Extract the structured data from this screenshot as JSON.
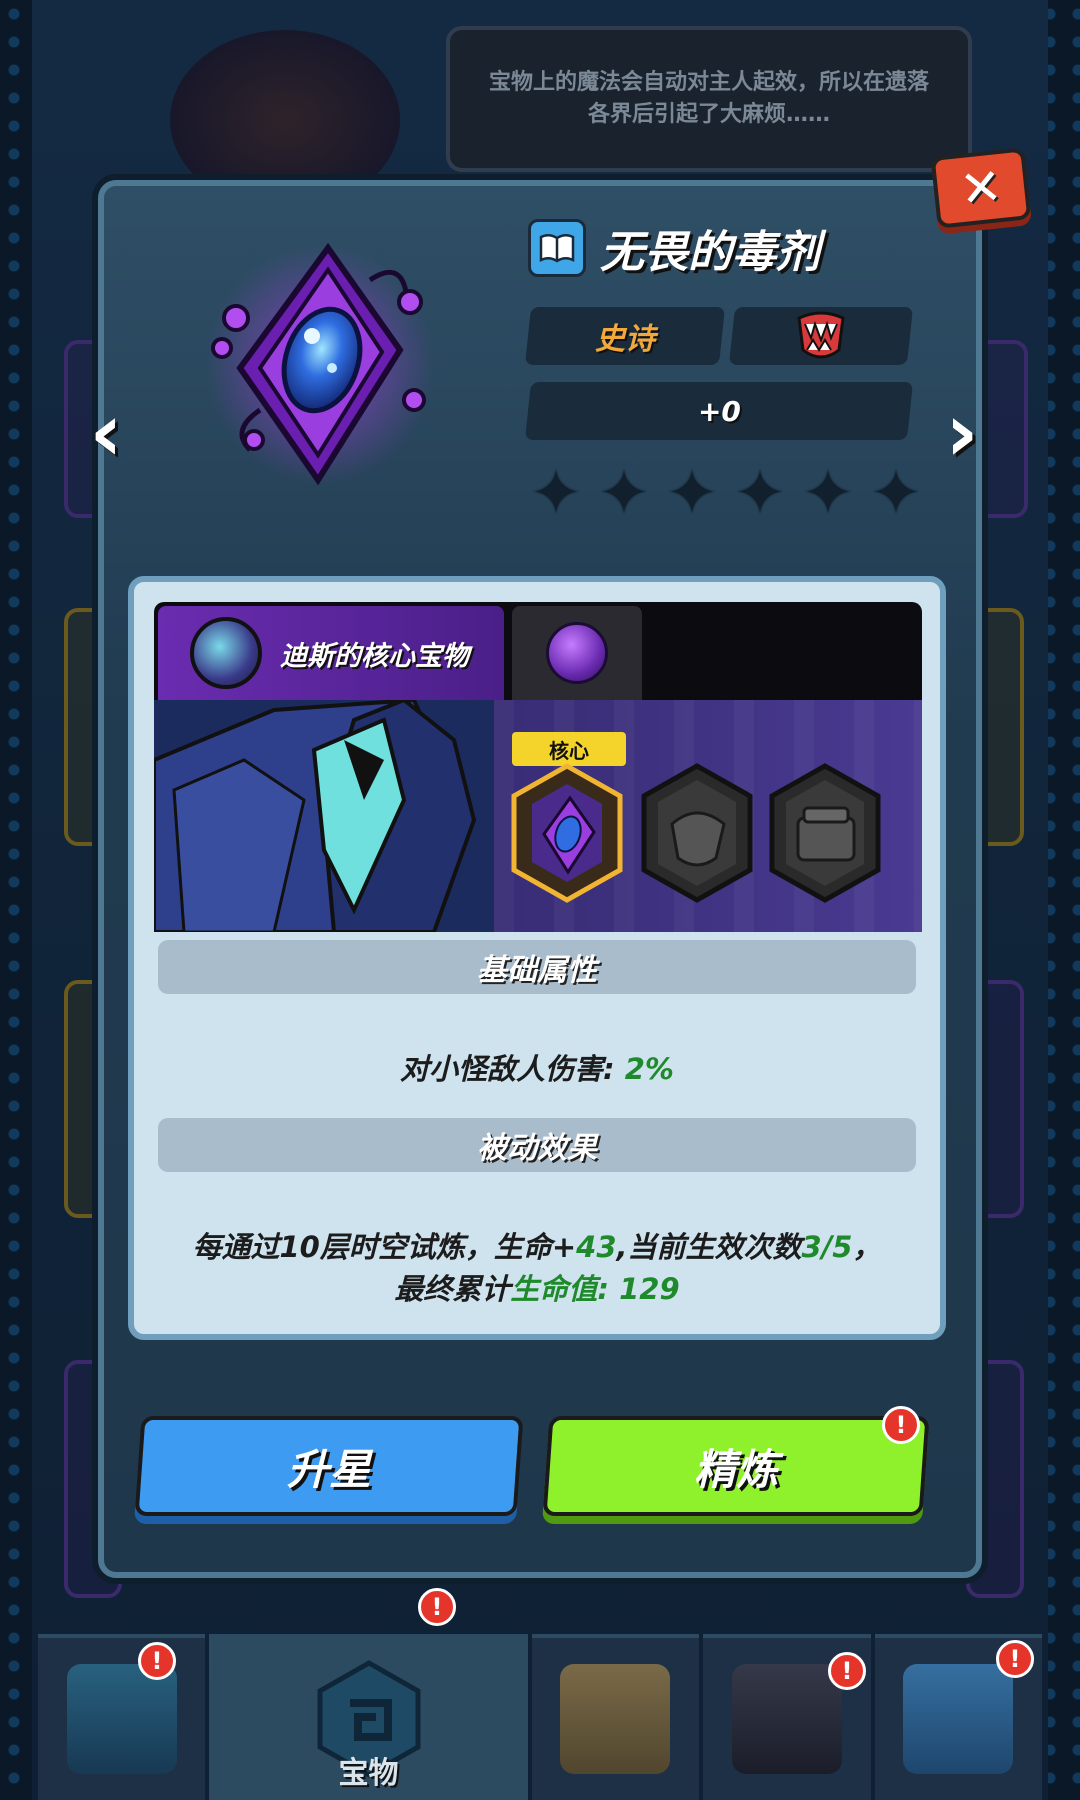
{
  "top_tip": {
    "text": "宝物上的魔法会自动对主人起效，所以在遗落各界后引起了大麻烦……"
  },
  "item": {
    "name": "无畏的毒剂",
    "rarity": "史诗",
    "level": "+0",
    "stars_filled": 0,
    "stars_total": 6
  },
  "set": {
    "tab_label": "迪斯的核心宝物",
    "core_badge": "核心"
  },
  "base_attr": {
    "header": "基础属性",
    "stat_label": "对小怪敌人伤害: ",
    "stat_value": "2%"
  },
  "passive": {
    "header": "被动效果",
    "line1_a": "每通过10层时空试炼，生命+",
    "line1_hp": "43",
    "line1_b": ",当前生效次数",
    "line1_count": "3/5",
    "line1_c": "，",
    "line2_a": "最终累计",
    "line2_b": "生命值: 129"
  },
  "buttons": {
    "upgrade_star": "升星",
    "refine": "精炼",
    "alert_mark": "!"
  },
  "bottom_nav": {
    "treasure_label": "宝物"
  },
  "colors": {
    "rarity": "#f2a93b",
    "green_value": "#1f8a2c",
    "blue_button": "#3d9bf2",
    "green_button": "#8ff12b",
    "close_button": "#e14a2c"
  }
}
